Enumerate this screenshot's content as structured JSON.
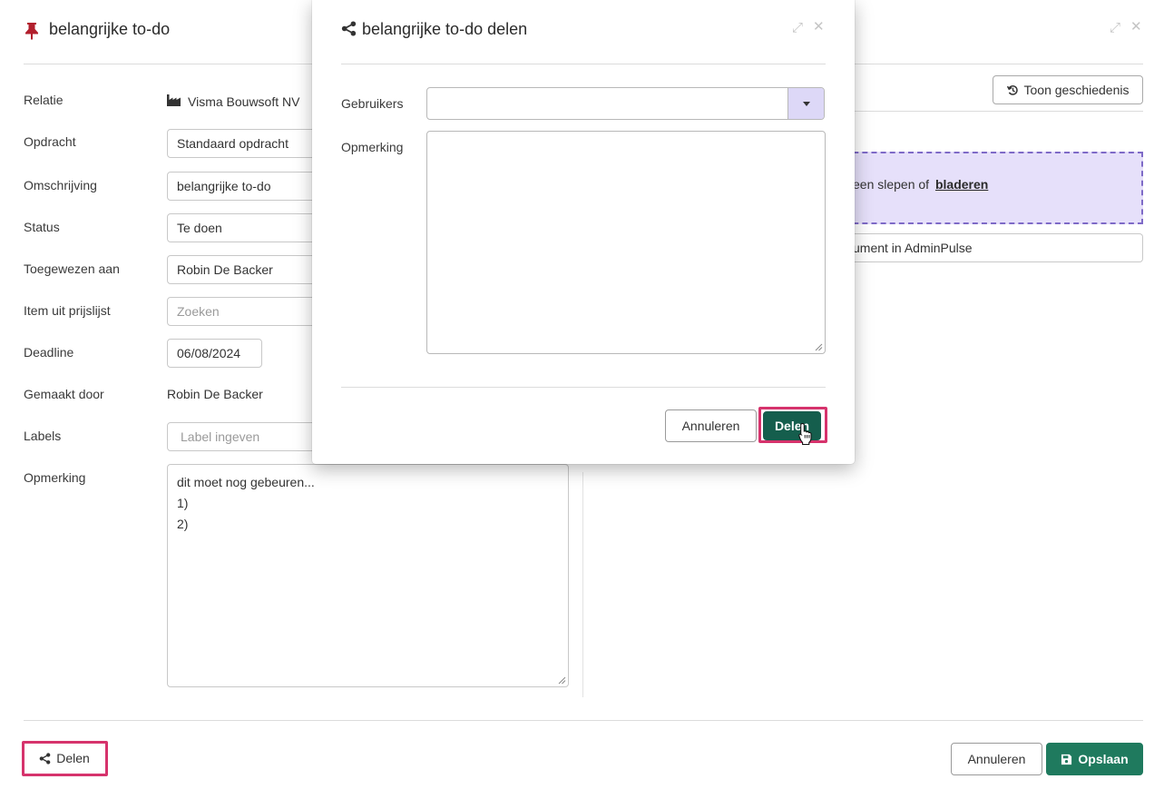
{
  "main": {
    "title": "belangrijke to-do",
    "history_button": "Toon geschiedenis",
    "fields": {
      "relatie_label": "Relatie",
      "relatie_value": "Visma Bouwsoft NV",
      "opdracht_label": "Opdracht",
      "opdracht_value": "Standaard opdracht",
      "omschrijving_label": "Omschrijving",
      "omschrijving_value": "belangrijke to-do",
      "status_label": "Status",
      "status_value": "Te doen",
      "toegewezen_label": "Toegewezen aan",
      "toegewezen_value": "Robin De Backer",
      "prijslijst_label": "Item uit prijslijst",
      "prijslijst_placeholder": "Zoeken",
      "deadline_label": "Deadline",
      "deadline_value": "06/08/2024",
      "gemaakt_label": "Gemaakt door",
      "gemaakt_value": "Robin De Backer",
      "labels_label": "Labels",
      "labels_placeholder": "Label ingeven",
      "opmerking_label": "Opmerking",
      "opmerking_lines": [
        "dit moet nog gebeuren...",
        "1)",
        "2)"
      ]
    },
    "dropzone_text": "een slepen of",
    "dropzone_link": "bladeren",
    "document_field": "ument in AdminPulse"
  },
  "footer": {
    "share_button": "Delen",
    "cancel_button": "Annuleren",
    "save_button": "Opslaan"
  },
  "modal": {
    "title": "belangrijke to-do delen",
    "users_label": "Gebruikers",
    "users_value": "",
    "remark_label": "Opmerking",
    "remark_value": "",
    "cancel_button": "Annuleren",
    "share_button": "Delen"
  },
  "colors": {
    "primary": "#1f7a5e",
    "highlight": "#d6336c",
    "pin_icon": "#b21f2d",
    "dropzone_bg": "#e6e0fa",
    "dropzone_border": "#7e6ac7"
  },
  "icons": [
    "pin-icon",
    "factory-icon",
    "history-icon",
    "share-icon",
    "save-icon",
    "expand-icon",
    "close-icon",
    "caret-down-icon",
    "cursor-hand-icon"
  ]
}
